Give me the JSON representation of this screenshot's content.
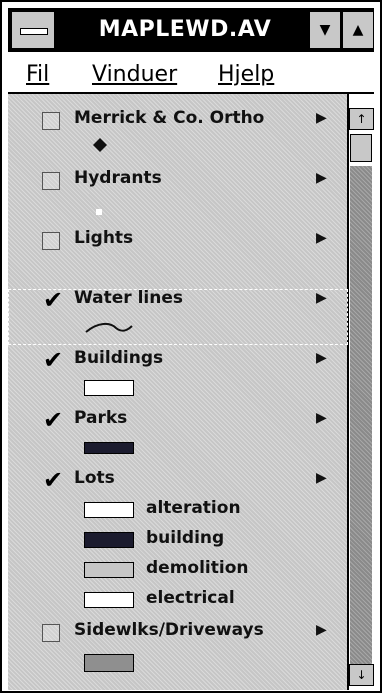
{
  "window": {
    "title": "MAPLEWD.AV"
  },
  "menu": [
    {
      "label": "Fil",
      "accel": "F"
    },
    {
      "label": "Vinduer",
      "accel": "V"
    },
    {
      "label": "Hjelp",
      "accel": "H"
    }
  ],
  "layers": [
    {
      "label": "Merrick & Co. Ortho",
      "checked": false
    },
    {
      "label": "Hydrants",
      "checked": false
    },
    {
      "label": "Lights",
      "checked": false
    },
    {
      "label": "Water lines",
      "checked": true,
      "selected": true
    },
    {
      "label": "Buildings",
      "checked": true
    },
    {
      "label": "Parks",
      "checked": true
    },
    {
      "label": "Lots",
      "checked": true
    },
    {
      "label": "Sidewlks/Driveways",
      "checked": false
    }
  ],
  "lots_legend": [
    {
      "label": "alteration",
      "color": "#ffffff"
    },
    {
      "label": "building",
      "color": "#1b1b2e"
    },
    {
      "label": "demolition",
      "color": "#c6c6c6"
    },
    {
      "label": "electrical",
      "color": "#ffffff"
    }
  ],
  "swatches": {
    "buildings": "#ffffff",
    "parks": "#1b1b2e",
    "sidewalks": "#8f8f8f"
  },
  "icons": {
    "expand": "▶",
    "checked": "✔",
    "scroll_up": "↑",
    "scroll_down": "↓",
    "minimize": "▼",
    "maximize": "▲"
  }
}
